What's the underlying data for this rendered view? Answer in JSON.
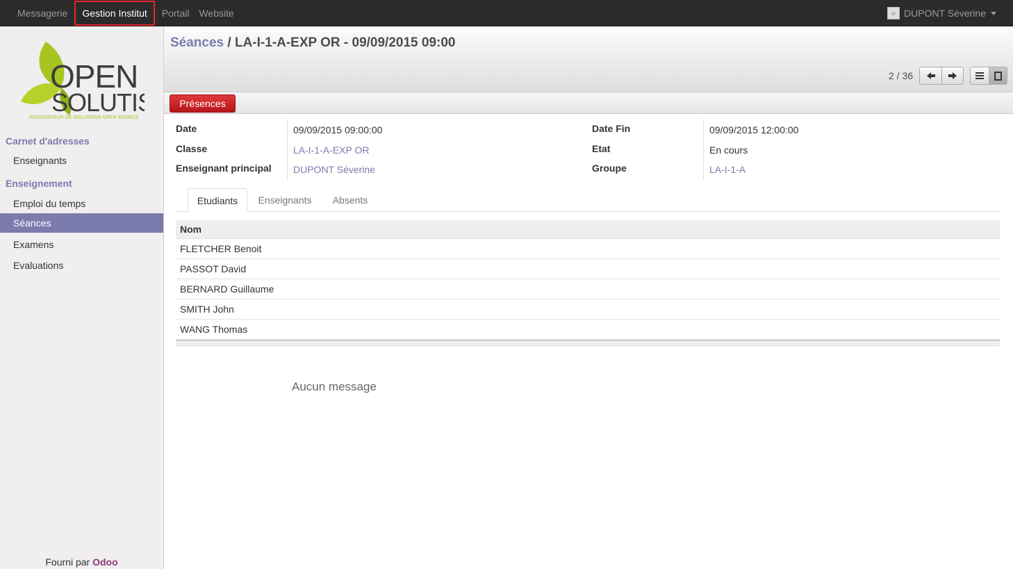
{
  "topbar": {
    "menu": [
      "Messagerie",
      "Gestion Institut",
      "Portail",
      "Website"
    ],
    "active_index": 1,
    "user_name": "DUPONT Séverine"
  },
  "sidebar": {
    "logo": {
      "word1": "OPEN",
      "word2": "SOLUTIS",
      "tagline": "INTEGRATEUR DE SOLUTIONS OPEN SOURCE"
    },
    "section1": {
      "title": "Carnet d'adresses",
      "items": [
        "Enseignants"
      ]
    },
    "section2": {
      "title": "Enseignement",
      "items": [
        "Emploi du temps",
        "Séances",
        "Examens",
        "Evaluations"
      ]
    },
    "active_item": "Séances",
    "footer_prefix": "Fourni par",
    "footer_brand": "Odoo"
  },
  "header": {
    "breadcrumb_link": "Séances",
    "separator": "/",
    "record_title": "LA-I-1-A-EXP OR - 09/09/2015 09:00",
    "pager": "2 / 36"
  },
  "toolbar": {
    "presences_label": "Présences"
  },
  "form": {
    "date_label": "Date",
    "date_value": "09/09/2015 09:00:00",
    "classe_label": "Classe",
    "classe_value": "LA-I-1-A-EXP OR",
    "enseignant_label": "Enseignant principal",
    "enseignant_value": "DUPONT Séverine",
    "date_fin_label": "Date Fin",
    "date_fin_value": "09/09/2015 12:00:00",
    "etat_label": "Etat",
    "etat_value": "En cours",
    "groupe_label": "Groupe",
    "groupe_value": "LA-I-1-A"
  },
  "tabs": [
    "Etudiants",
    "Enseignants",
    "Absents"
  ],
  "active_tab": "Etudiants",
  "table": {
    "header": "Nom",
    "rows": [
      "FLETCHER Benoit",
      "PASSOT David",
      "BERNARD Guillaume",
      "SMITH John",
      "WANG Thomas"
    ]
  },
  "chatter": {
    "empty_message": "Aucun message"
  },
  "colors": {
    "accent": "#7c7bad",
    "button_red": "#c9252b",
    "topbar": "#2b2b2b",
    "highlight_box": "#e8262a"
  }
}
